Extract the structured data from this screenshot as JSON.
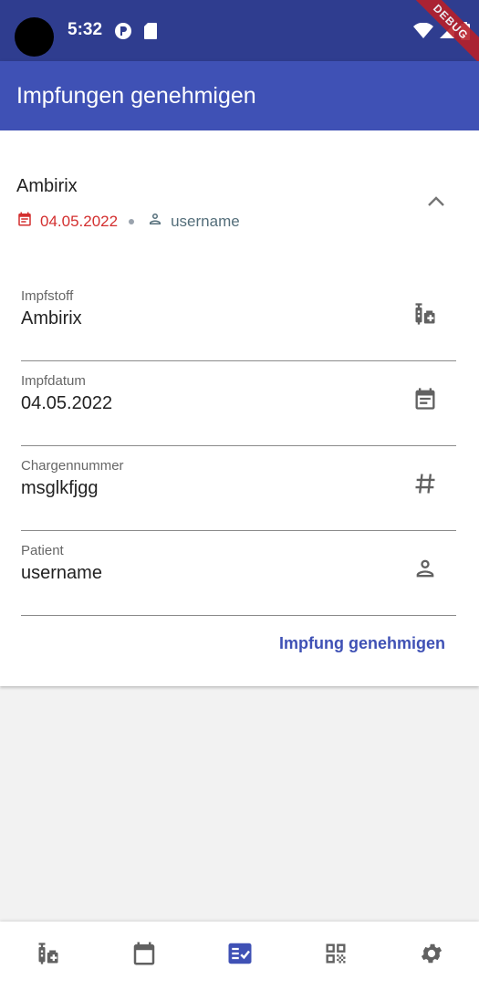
{
  "status_bar": {
    "time": "5:32",
    "debug_label": "DEBUG"
  },
  "app_bar": {
    "title": "Impfungen genehmigen"
  },
  "card": {
    "title": "Ambirix",
    "date": "04.05.2022",
    "user": "username",
    "fields": [
      {
        "label": "Impfstoff",
        "value": "Ambirix",
        "icon": "vaccine-icon"
      },
      {
        "label": "Impfdatum",
        "value": "04.05.2022",
        "icon": "calendar-icon"
      },
      {
        "label": "Chargennummer",
        "value": "msglkfjgg",
        "icon": "hash-icon"
      },
      {
        "label": "Patient",
        "value": "username",
        "icon": "person-icon"
      }
    ],
    "action_label": "Impfung genehmigen"
  },
  "bottom_nav": {
    "items": [
      "vaccine-icon",
      "calendar-icon",
      "approval-list-icon",
      "qr-code-icon",
      "settings-icon"
    ],
    "active_index": 2
  },
  "colors": {
    "status_bar": "#2f3d8f",
    "primary": "#3f51b5",
    "date_red": "#d32f2f",
    "user_grey": "#546e7a",
    "icon_grey": "#616161"
  }
}
